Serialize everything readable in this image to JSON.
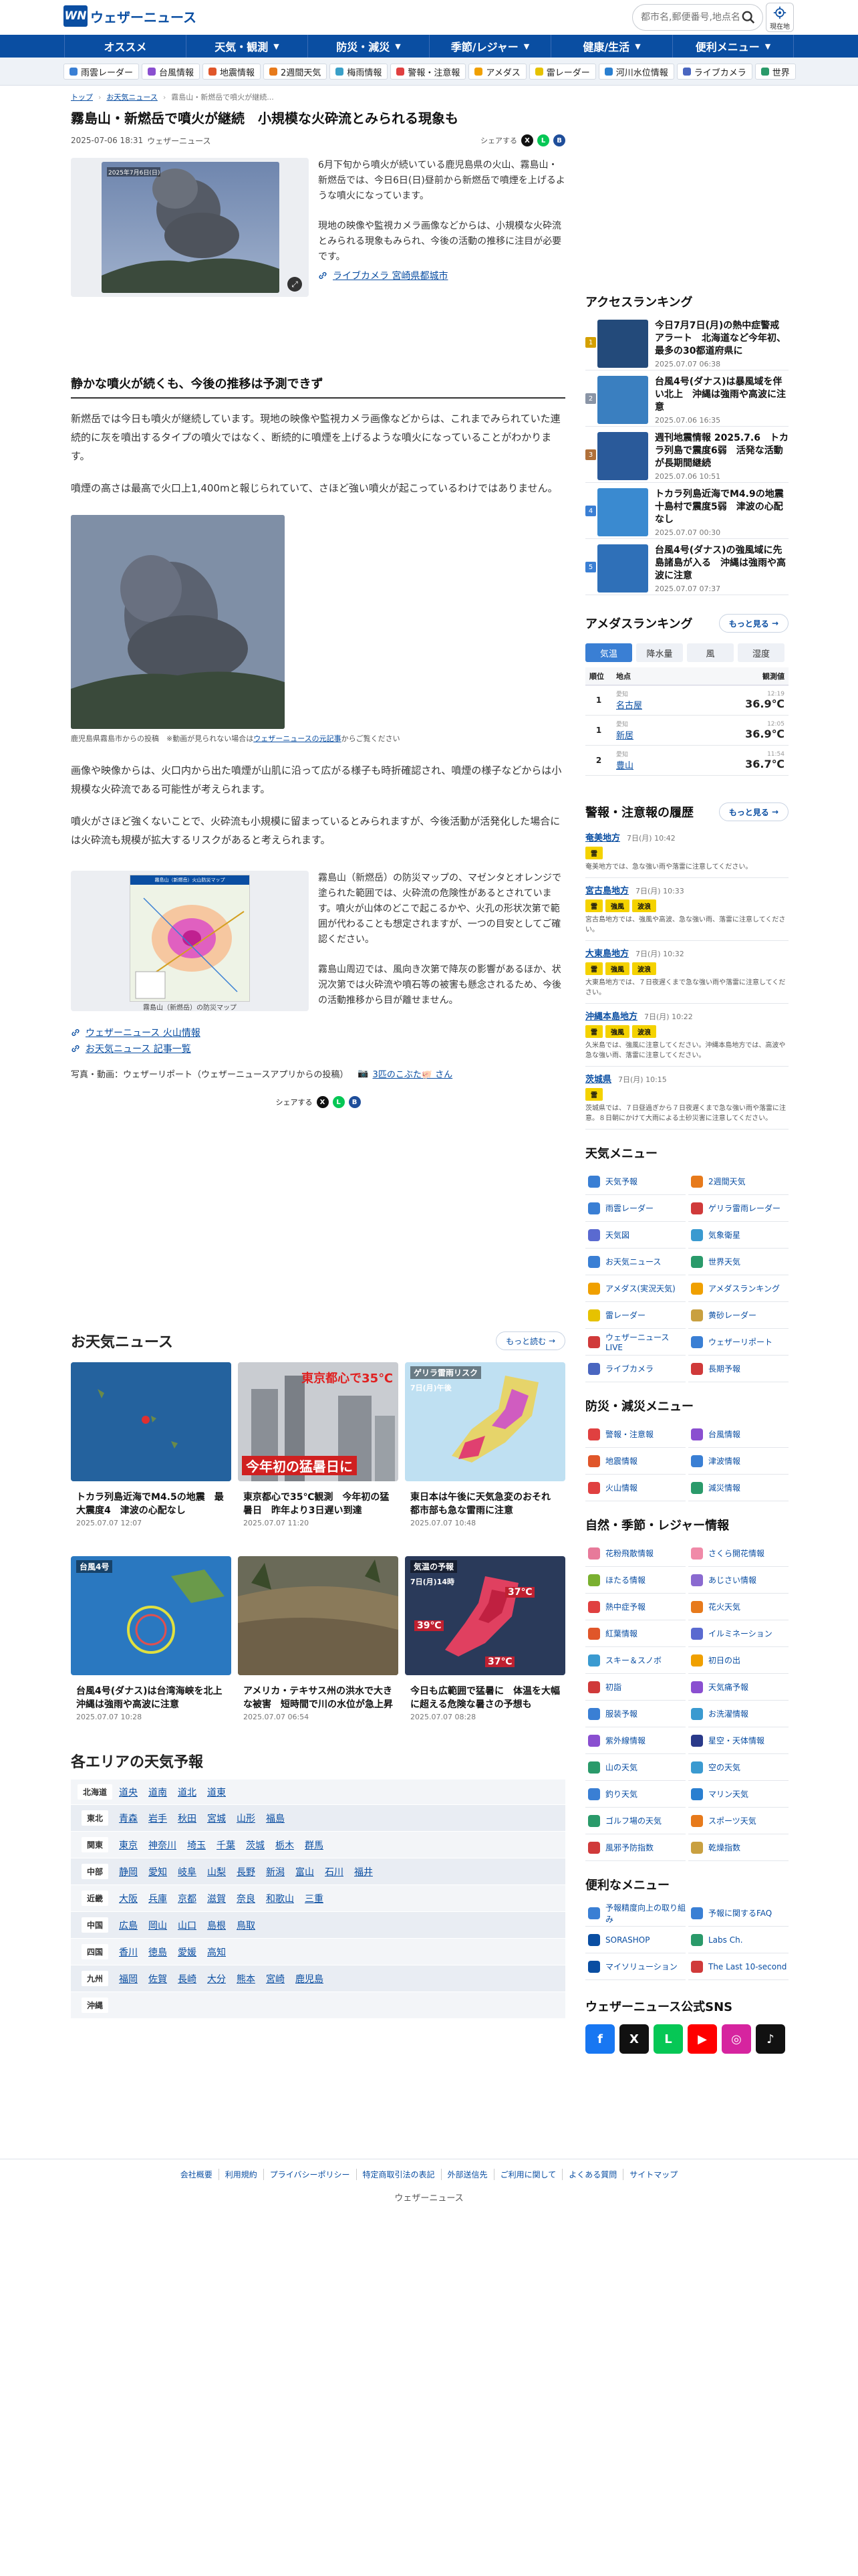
{
  "header": {
    "logo_mark": "WN",
    "logo_text": "ウェザーニュース",
    "search_placeholder": "都市名,郵便番号,地点名",
    "location_label": "現在地"
  },
  "global_nav": [
    {
      "label": "オススメ",
      "arrow": ""
    },
    {
      "label": "天気・観測",
      "arrow": "▼"
    },
    {
      "label": "防災・減災",
      "arrow": "▼"
    },
    {
      "label": "季節/レジャー",
      "arrow": "▼"
    },
    {
      "label": "健康/生活",
      "arrow": "▼"
    },
    {
      "label": "便利メニュー",
      "arrow": "▼"
    }
  ],
  "sub_nav": [
    {
      "label": "雨雲レーダー",
      "color": "#3a7fd4"
    },
    {
      "label": "台風情報",
      "color": "#8a4fd0"
    },
    {
      "label": "地震情報",
      "color": "#e0562a"
    },
    {
      "label": "2週間天気",
      "color": "#e77a1b"
    },
    {
      "label": "梅雨情報",
      "color": "#3aa0c8"
    },
    {
      "label": "警報・注意報",
      "color": "#e04040"
    },
    {
      "label": "アメダス",
      "color": "#f0a000"
    },
    {
      "label": "雷レーダー",
      "color": "#e6c200"
    },
    {
      "label": "河川水位情報",
      "color": "#2a7fd0"
    },
    {
      "label": "ライブカメラ",
      "color": "#4a66c0"
    },
    {
      "label": "世界",
      "color": "#2a9a6a"
    }
  ],
  "breadcrumb": [
    "トップ",
    "お天気ニュース",
    "霧島山・新燃岳で噴火が継続..."
  ],
  "article": {
    "title": "霧島山・新燃岳で噴火が継続　小規模な火砕流とみられる現象も",
    "date": "2025-07-06 18:31",
    "source": "ウェザーニュース",
    "share_label": "シェアする",
    "photo_caption_overlay": "2025年7月6日(日)",
    "lead_p1": "6月下旬から噴火が続いている鹿児島県の火山、霧島山・新燃岳では、今日6日(日)昼前から新燃岳で噴煙を上げるような噴火になっています。",
    "lead_p2": "現地の映像や監視カメラ画像などからは、小規模な火砕流とみられる現象もみられ、今後の活動の推移に注目が必要です。",
    "live_camera_link": "ライブカメラ 宮崎県都城市",
    "section_title": "静かな噴火が続くも、今後の推移は予測できず",
    "body_p1": "新燃岳では今日も噴火が継続しています。現地の映像や監視カメラ画像などからは、これまでみられていた連続的に灰を噴出するタイプの噴火ではなく、断続的に噴煙を上げるような噴火になっていることがわかります。",
    "body_p2": "噴煙の高さは最高で火口上1,400mと報じられていて、さほど強い噴火が起こっているわけではありません。",
    "img2_caption_pre": "鹿児島県霧島市からの投稿　※動画が見られない場合は",
    "img2_caption_link": "ウェザーニュースの元記事",
    "img2_caption_post": "からご覧ください",
    "body_p3": "画像や映像からは、火口内から出た噴煙が山肌に沿って広がる様子も時折確認され、噴煙の様子などからは小規模な火砕流である可能性が考えられます。",
    "body_p4": "噴火がさほど強くないことで、火砕流も小規模に留まっているとみられますが、今後活動が活発化した場合には火砕流も規模が拡大するリスクがあると考えられます。",
    "map_caption": "霧島山（新燃岳）の防災マップ",
    "map_title": "霧島山（新燃岳）火山防災マップ",
    "map_p1": "霧島山（新燃岳）の防災マップの、マゼンタとオレンジで塗られた範囲では、火砕流の危険性があるとされています。噴火が山体のどこで起こるかや、火孔の形状次第で範囲が代わることも想定されますが、一つの目安としてご確認ください。",
    "map_p2": "霧島山周辺では、風向き次第で降灰の影響があるほか、状況次第では火砕流や噴石等の被害も懸念されるため、今後の活動推移から目が離せません。",
    "link1": "ウェザーニュース 火山情報",
    "link2": "お天気ニュース 記事一覧",
    "credit_pre": "写真・動画：ウェザーリポート（ウェザーニュースアプリからの投稿）",
    "credit_user": "3匹のこぶた🐖 さん"
  },
  "news": {
    "title": "お天気ニュース",
    "more": "もっと読む",
    "items": [
      {
        "title": "トカラ列島近海でM4.5の地震　最大震度4　津波の心配なし",
        "date": "2025.07.07 12:07",
        "overlay": ""
      },
      {
        "title": "東京都心で35℃観測　今年初の猛暑日　昨年より3日遅い到達",
        "date": "2025.07.07 11:20",
        "overlay": "東京都心で35℃",
        "overlay2": "今年初の猛暑日に"
      },
      {
        "title": "東日本は午後に天気急変のおそれ　都市部も急な雷雨に注意",
        "date": "2025.07.07 10:48",
        "overlay": "ゲリラ雷雨リスク",
        "overlay2": "7日(月)午後"
      },
      {
        "title": "台風4号(ダナス)は台湾海峡を北上　沖縄は強雨や高波に注意",
        "date": "2025.07.07 10:28",
        "overlay": "台風4号",
        "overlay2": ""
      },
      {
        "title": "アメリカ・テキサス州の洪水で大きな被害　短時間で川の水位が急上昇",
        "date": "2025.07.07 06:54",
        "overlay": "",
        "overlay2": ""
      },
      {
        "title": "今日も広範囲で猛暑に　体温を大幅に超える危険な暑さの予想も",
        "date": "2025.07.07 08:28",
        "overlay": "気温の予報",
        "overlay2": "7日(月)14時",
        "t1": "37℃",
        "t2": "39℃",
        "t3": "37℃"
      }
    ]
  },
  "areas": {
    "title": "各エリアの天気予報",
    "rows": [
      {
        "region": "北海道",
        "prefs": [
          "道央",
          "道南",
          "道北",
          "道東"
        ]
      },
      {
        "region": "東北",
        "prefs": [
          "青森",
          "岩手",
          "秋田",
          "宮城",
          "山形",
          "福島"
        ]
      },
      {
        "region": "関東",
        "prefs": [
          "東京",
          "神奈川",
          "埼玉",
          "千葉",
          "茨城",
          "栃木",
          "群馬"
        ]
      },
      {
        "region": "中部",
        "prefs": [
          "静岡",
          "愛知",
          "岐阜",
          "山梨",
          "長野",
          "新潟",
          "富山",
          "石川",
          "福井"
        ]
      },
      {
        "region": "近畿",
        "prefs": [
          "大阪",
          "兵庫",
          "京都",
          "滋賀",
          "奈良",
          "和歌山",
          "三重"
        ]
      },
      {
        "region": "中国",
        "prefs": [
          "広島",
          "岡山",
          "山口",
          "島根",
          "鳥取"
        ]
      },
      {
        "region": "四国",
        "prefs": [
          "香川",
          "徳島",
          "愛媛",
          "高知"
        ]
      },
      {
        "region": "九州",
        "prefs": [
          "福岡",
          "佐賀",
          "長崎",
          "大分",
          "熊本",
          "宮崎",
          "鹿児島"
        ]
      },
      {
        "region": "沖縄",
        "prefs": []
      }
    ]
  },
  "sidebar": {
    "ranking_title": "アクセスランキング",
    "ranking": [
      {
        "num": "1",
        "title": "今日7月7日(月)の熱中症警戒アラート　北海道など今年初、最多の30都道府県に",
        "date": "2025.07.07 06:38"
      },
      {
        "num": "2",
        "title": "台風4号(ダナス)は暴風域を伴い北上　沖縄は強雨や高波に注意",
        "date": "2025.07.06 16:35"
      },
      {
        "num": "3",
        "title": "週刊地震情報 2025.7.6　トカラ列島で震度6弱　活発な活動が長期間継続",
        "date": "2025.07.06 10:51"
      },
      {
        "num": "4",
        "title": "トカラ列島近海でM4.9の地震　十島村で震度5弱　津波の心配なし",
        "date": "2025.07.07 00:30"
      },
      {
        "num": "5",
        "title": "台風4号(ダナス)の強風域に先島諸島が入る　沖縄は強雨や高波に注意",
        "date": "2025.07.07 07:37"
      }
    ],
    "amedas_title": "アメダスランキング",
    "more": "もっと見る",
    "amedas_tabs": [
      "気温",
      "降水量",
      "風",
      "湿度"
    ],
    "amedas_head": [
      "順位",
      "地点",
      "観測値"
    ],
    "amedas_rows": [
      {
        "rank": "1",
        "pref": "愛知",
        "place": "名古屋",
        "time": "12:19",
        "value": "36.9℃"
      },
      {
        "rank": "1",
        "pref": "愛知",
        "place": "新居",
        "time": "12:05",
        "value": "36.9℃"
      },
      {
        "rank": "2",
        "pref": "愛知",
        "place": "豊山",
        "time": "11:54",
        "value": "36.7℃"
      }
    ],
    "warn_title": "警報・注意報の履歴",
    "warnings": [
      {
        "area": "奄美地方",
        "time": "7日(月) 10:42",
        "badges": [
          "雷"
        ],
        "desc": "奄美地方では、急な強い雨や落雷に注意してください。"
      },
      {
        "area": "宮古島地方",
        "time": "7日(月) 10:33",
        "badges": [
          "雷",
          "強風",
          "波浪"
        ],
        "desc": "宮古島地方では、強風や高波、急な強い雨、落雷に注意してください。"
      },
      {
        "area": "大東島地方",
        "time": "7日(月) 10:32",
        "badges": [
          "雷",
          "強風",
          "波浪"
        ],
        "desc": "大東島地方では、７日夜遅くまで急な強い雨や落雷に注意してください。"
      },
      {
        "area": "沖縄本島地方",
        "time": "7日(月) 10:22",
        "badges": [
          "雷",
          "強風",
          "波浪"
        ],
        "desc": "久米島では、強風に注意してください。沖縄本島地方では、高波や急な強い雨、落雷に注意してください。"
      },
      {
        "area": "茨城県",
        "time": "7日(月) 10:15",
        "badges": [
          "雷"
        ],
        "desc": "茨城県では、７日昼過ぎから７日夜遅くまで急な強い雨や落雷に注意。８日朝にかけて大雨による土砂災害に注意してください。"
      }
    ],
    "menu_title": "天気メニュー",
    "menu": [
      {
        "label": "天気予報",
        "color": "#3a7fd4"
      },
      {
        "label": "2週間天気",
        "color": "#e77a1b"
      },
      {
        "label": "雨雲レーダー",
        "color": "#3a7fd4"
      },
      {
        "label": "ゲリラ雷雨レーダー",
        "color": "#d03a3a"
      },
      {
        "label": "天気図",
        "color": "#5a6ad0"
      },
      {
        "label": "気象衛星",
        "color": "#3a9ad0"
      },
      {
        "label": "お天気ニュース",
        "color": "#3a7fd4"
      },
      {
        "label": "世界天気",
        "color": "#2a9a6a"
      },
      {
        "label": "アメダス(実況天気)",
        "color": "#f0a000"
      },
      {
        "label": "アメダスランキング",
        "color": "#f0a000"
      },
      {
        "label": "雷レーダー",
        "color": "#e6c200"
      },
      {
        "label": "黄砂レーダー",
        "color": "#c9a040"
      },
      {
        "label": "ウェザーニュースLIVE",
        "color": "#d03a3a"
      },
      {
        "label": "ウェザーリポート",
        "color": "#3a7fd4"
      },
      {
        "label": "ライブカメラ",
        "color": "#4a66c0"
      },
      {
        "label": "長期予報",
        "color": "#d03a3a"
      }
    ],
    "bosai_title": "防災・減災メニュー",
    "bosai": [
      {
        "label": "警報・注意報",
        "color": "#e04040"
      },
      {
        "label": "台風情報",
        "color": "#8a4fd0"
      },
      {
        "label": "地震情報",
        "color": "#e0562a"
      },
      {
        "label": "津波情報",
        "color": "#3a7fd4"
      },
      {
        "label": "火山情報",
        "color": "#e04040"
      },
      {
        "label": "減災情報",
        "color": "#2a9a6a"
      }
    ],
    "leisure_title": "自然・季節・レジャー情報",
    "leisure": [
      {
        "label": "花粉飛散情報",
        "color": "#e77a9a"
      },
      {
        "label": "さくら開花情報",
        "color": "#f08aa8"
      },
      {
        "label": "ほたる情報",
        "color": "#7ab030"
      },
      {
        "label": "あじさい情報",
        "color": "#8a6ad0"
      },
      {
        "label": "熱中症予報",
        "color": "#e04040"
      },
      {
        "label": "花火天気",
        "color": "#e77a1b"
      },
      {
        "label": "紅葉情報",
        "color": "#e0562a"
      },
      {
        "label": "イルミネーション",
        "color": "#5a6ad0"
      },
      {
        "label": "スキー＆スノボ",
        "color": "#3a9ad0"
      },
      {
        "label": "初日の出",
        "color": "#f0a000"
      },
      {
        "label": "初詣",
        "color": "#d03a3a"
      },
      {
        "label": "天気痛予報",
        "color": "#8a4fd0"
      },
      {
        "label": "服装予報",
        "color": "#3a7fd4"
      },
      {
        "label": "お洗濯情報",
        "color": "#3a9ad0"
      },
      {
        "label": "紫外線情報",
        "color": "#8a4fd0"
      },
      {
        "label": "星空・天体情報",
        "color": "#2a3a8a"
      },
      {
        "label": "山の天気",
        "color": "#2a9a6a"
      },
      {
        "label": "空の天気",
        "color": "#3a9ad0"
      },
      {
        "label": "釣り天気",
        "color": "#3a7fd4"
      },
      {
        "label": "マリン天気",
        "color": "#2a7fd0"
      },
      {
        "label": "ゴルフ場の天気",
        "color": "#2a9a6a"
      },
      {
        "label": "スポーツ天気",
        "color": "#e77a1b"
      },
      {
        "label": "風邪予防指数",
        "color": "#d03a3a"
      },
      {
        "label": "乾燥指数",
        "color": "#c9a040"
      }
    ],
    "useful_title": "便利なメニュー",
    "useful": [
      {
        "label": "予報精度向上の取り組み",
        "color": "#3a7fd4"
      },
      {
        "label": "予報に関するFAQ",
        "color": "#3a7fd4"
      },
      {
        "label": "SORASHOP",
        "color": "#0a4ea2"
      },
      {
        "label": "Labs Ch.",
        "color": "#2a9a6a"
      },
      {
        "label": "マイソリューション",
        "color": "#0a4ea2"
      },
      {
        "label": "The Last 10-second",
        "color": "#d03a3a"
      }
    ],
    "sns_title": "ウェザーニュース公式SNS",
    "sns": [
      {
        "label": "f",
        "color": "#1877f2"
      },
      {
        "label": "X",
        "color": "#111111"
      },
      {
        "label": "L",
        "color": "#06c755"
      },
      {
        "label": "▶",
        "color": "#ff0000"
      },
      {
        "label": "◎",
        "color": "#d6249f"
      },
      {
        "label": "♪",
        "color": "#111111"
      }
    ]
  },
  "footer": {
    "links": [
      "会社概要",
      "利用規約",
      "プライバシーポリシー",
      "特定商取引法の表記",
      "外部送信先",
      "ご利用に関して",
      "よくある質問",
      "サイトマップ"
    ],
    "copyright": "ウェザーニュース"
  }
}
